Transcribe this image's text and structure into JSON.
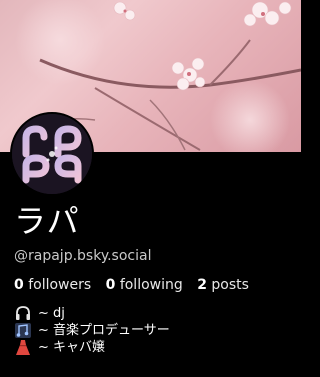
{
  "profile": {
    "display_name": "ラパ",
    "handle": "@rapajp.bsky.social",
    "avatar_text": "rapa"
  },
  "stats": {
    "followers_count": "0",
    "followers_label": "followers",
    "following_count": "0",
    "following_label": "following",
    "posts_count": "2",
    "posts_label": "posts"
  },
  "bio": [
    {
      "icon": "headphones-icon",
      "text": "~ dj"
    },
    {
      "icon": "music-note-icon",
      "text": "~ 音楽プロデューサー"
    },
    {
      "icon": "dress-icon",
      "text": "~ キャバ嬢"
    }
  ],
  "colors": {
    "background": "#000000",
    "banner": "#e8b5bb",
    "handle": "#c9c9c9"
  }
}
